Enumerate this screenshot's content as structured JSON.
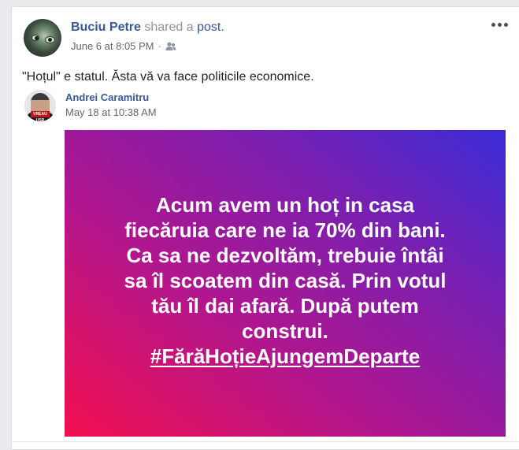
{
  "post": {
    "author": "Buciu Petre",
    "action": "shared a",
    "object": "post.",
    "date": "June 6 at 8:05 PM",
    "separator": "·",
    "privacy_icon": "friends-icon",
    "text": "\"Hoțul\" e statul. Ăsta vă va face politicile economice."
  },
  "shared": {
    "author": "Andrei Caramitru",
    "date": "May 18 at 10:38 AM",
    "avatar_badge": "VREAU USR PLUS",
    "image_lines": [
      "Acum avem un hoț in casa",
      "fiecăruia care ne ia 70% din bani.",
      "Ca sa ne dezvoltăm, trebuie întâi",
      "sa îl scoatem din casă. Prin votul",
      "tău îl dai afară. După putem",
      "construi."
    ],
    "hashtag": "#FărăHoțieAjungemDeparte"
  },
  "colors": {
    "link": "#385898",
    "gradient_start": "#3a2cd6",
    "gradient_end": "#f20f4e"
  }
}
